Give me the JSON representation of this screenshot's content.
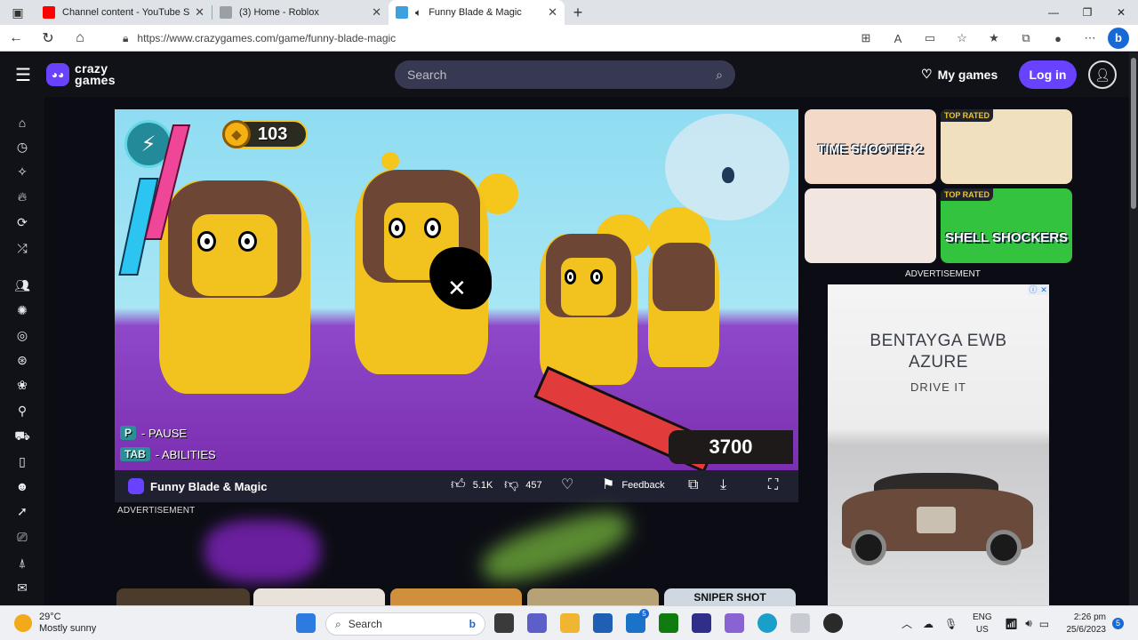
{
  "browser": {
    "tabs": [
      {
        "title": "Channel content - YouTube Studi",
        "favicon_color": "#ff0000",
        "active": false
      },
      {
        "title": "(3) Home - Roblox",
        "favicon_color": "#9aa0a6",
        "active": false
      },
      {
        "title": "Funny Blade & Magic",
        "favicon_color": "#3da1e0",
        "active": true
      }
    ],
    "url": "https://www.crazygames.com/game/funny-blade-magic",
    "bing_label": "b"
  },
  "site": {
    "logo_line1": "crazy",
    "logo_line2": "games",
    "search_placeholder": "Search",
    "my_games": "My games",
    "login": "Log in",
    "accent_color": "#6842ff"
  },
  "game": {
    "title": "Funny Blade & Magic",
    "coins": "103",
    "score": "3700",
    "hints": [
      {
        "key": "P",
        "action": "- PAUSE"
      },
      {
        "key": "TAB",
        "action": "- ABILITIES"
      }
    ],
    "likes": "5.1K",
    "dislikes": "457",
    "feedback": "Feedback"
  },
  "ads": {
    "bottom_label": "ADVERTISEMENT",
    "right_label": "ADVERTISEMENT",
    "brand_line1": "BENTAYGA EWB",
    "brand_line2": "AZURE",
    "cta": "DRIVE IT"
  },
  "related_games": [
    {
      "title": "TIME SHOOTER 2",
      "badge": "",
      "bg": "#f3d9c8"
    },
    {
      "title": "",
      "badge": "TOP RATED",
      "bg": "#f0e0c0"
    },
    {
      "title": "",
      "badge": "",
      "bg": "#f2e6e1"
    },
    {
      "title": "SHELL SHOCKERS",
      "badge": "TOP RATED",
      "bg": "#34c33f"
    }
  ],
  "bottom_strip": {
    "sniper_title": "SNIPER SHOT"
  },
  "taskbar": {
    "temperature": "29°C",
    "weather": "Mostly sunny",
    "search": "Search",
    "language_line1": "ENG",
    "language_line2": "US",
    "time": "2:26 pm",
    "date": "25/6/2023",
    "notifications": "5",
    "mail_badge": "5"
  }
}
